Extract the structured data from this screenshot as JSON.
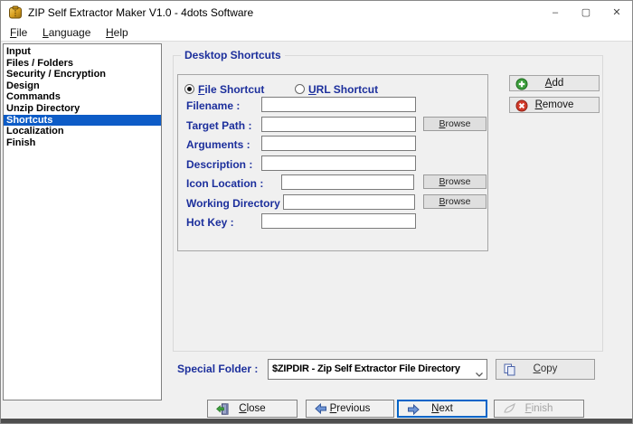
{
  "window": {
    "title": "ZIP Self Extractor Maker V1.0 - 4dots Software",
    "controls": {
      "minimize": "–",
      "maximize": "▢",
      "close": "✕"
    }
  },
  "menu": {
    "items": [
      "File",
      "Language",
      "Help"
    ]
  },
  "sidebar": {
    "items": [
      "Input",
      "Files / Folders",
      "Security / Encryption",
      "Design",
      "Commands",
      "Unzip Directory",
      "Shortcuts",
      "Localization",
      "Finish"
    ],
    "selected": "Shortcuts"
  },
  "form": {
    "group_title": "Desktop Shortcuts",
    "radio_file": {
      "label": "File Shortcut",
      "selected": true
    },
    "radio_url": {
      "label": "URL Shortcut",
      "selected": false
    },
    "browse_label": "Browse",
    "fields": [
      {
        "label": "Filename :",
        "value": ""
      },
      {
        "label": "Target Path :",
        "value": "",
        "browse": true
      },
      {
        "label": "Arguments :",
        "value": ""
      },
      {
        "label": "Description :",
        "value": ""
      },
      {
        "label": "Icon Location :",
        "value": "",
        "browse": true
      },
      {
        "label": "Working Directory :",
        "value": "",
        "browse": true
      },
      {
        "label": "Hot Key :",
        "value": ""
      }
    ],
    "add_label": "Add",
    "remove_label": "Remove"
  },
  "special_folder": {
    "label": "Special Folder :",
    "value": "$ZIPDIR - Zip Self Extractor File Directory",
    "copy_label": "Copy"
  },
  "footer": {
    "close_label": "Close",
    "previous_label": "Previous",
    "next_label": "Next",
    "finish_label": "Finish"
  },
  "colors": {
    "label_blue": "#1c2f9c",
    "selection_blue": "#0d5cc7",
    "next_border_blue": "#0064c8",
    "add_green": "#3d9e3d",
    "remove_red": "#d23a2a"
  }
}
